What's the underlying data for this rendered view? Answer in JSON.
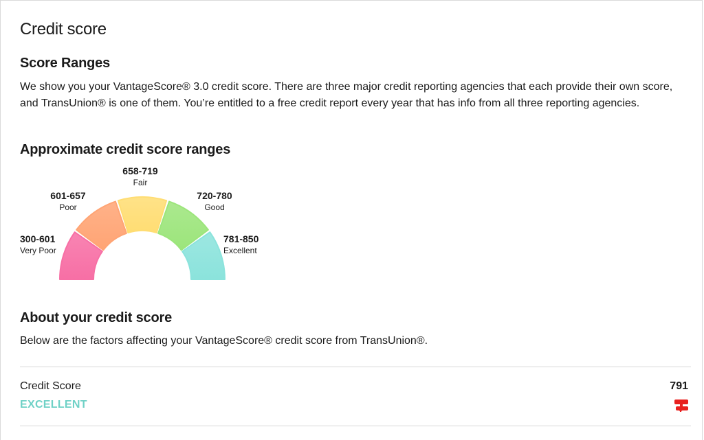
{
  "page": {
    "title": "Credit score"
  },
  "ranges": {
    "heading": "Score Ranges",
    "description": "We show you your VantageScore® 3.0 credit score. There are three major credit reporting agencies that each provide their own score, and TransUnion® is one of them. You’re entitled to a free credit report every year that has info from all three reporting agencies."
  },
  "gauge": {
    "heading": "Approximate credit score ranges",
    "segments": [
      {
        "range": "300-601",
        "name": "Very Poor",
        "color": "#f76fa5"
      },
      {
        "range": "601-657",
        "name": "Poor",
        "color": "#ffa474"
      },
      {
        "range": "658-719",
        "name": "Fair",
        "color": "#ffdd73"
      },
      {
        "range": "720-780",
        "name": "Good",
        "color": "#9ce57b"
      },
      {
        "range": "781-850",
        "name": "Excellent",
        "color": "#8be3dc"
      }
    ]
  },
  "about": {
    "heading": "About your credit score",
    "description": "Below are the factors affecting your VantageScore® credit score from TransUnion®."
  },
  "score": {
    "label": "Credit Score",
    "value": "791",
    "rating": "EXCELLENT",
    "rating_color": "#6fd1c6",
    "bureau_icon": "transunion-logo-icon"
  }
}
